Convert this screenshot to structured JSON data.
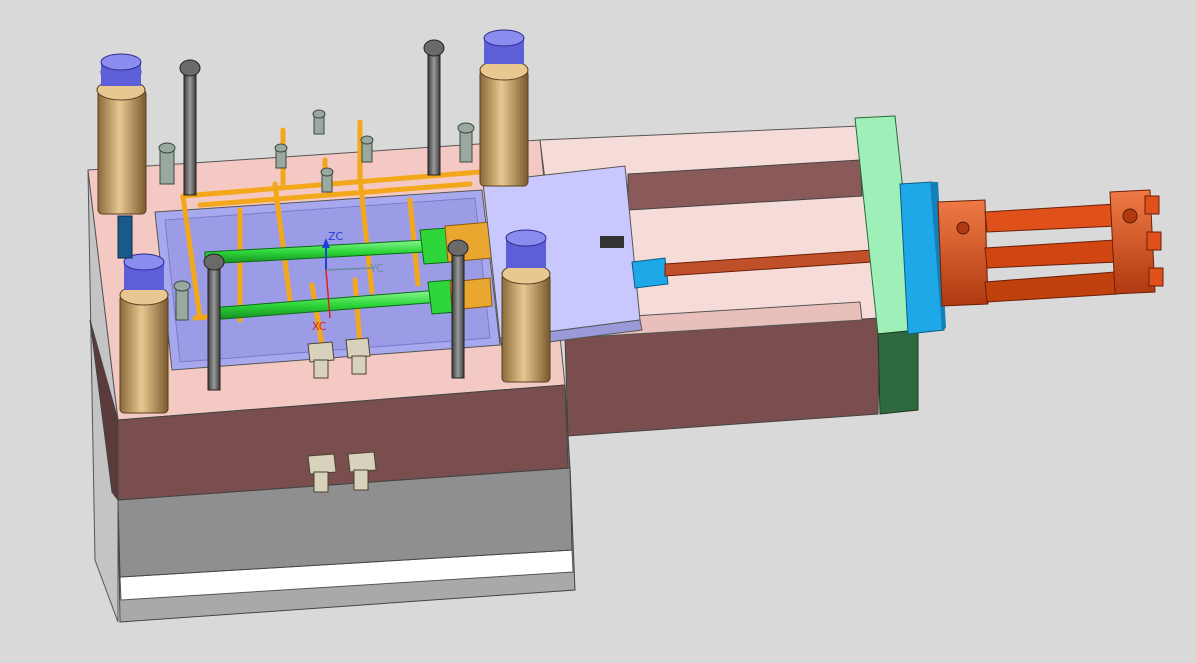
{
  "viewport": {
    "background": "#d9d9d9"
  },
  "triad": {
    "z_label": "ZC",
    "y_label": "YC",
    "x_label": "XC",
    "z_color": "#1f3fd6",
    "y_color": "#6b8aa0",
    "x_color": "#e02020"
  },
  "colors": {
    "clamp_plate_top": "#f4c9c4",
    "clamp_plate_side": "#7a4e4e",
    "lower_block": "#b8b8b8",
    "cavity_insert": "#a8a8ee",
    "slide_block": "#c8c8ff",
    "cooling_channel": "#f2a81a",
    "green_channel": "#2dd63a",
    "leader_bushing": "#c8a46a",
    "leader_cap": "#5d5fd8",
    "ejector_pin": "#5c5c5c",
    "green_plate": "#9ff0b8",
    "blue_plate": "#1ea8e8",
    "hydraulic_cylinder": "#e0501a"
  }
}
